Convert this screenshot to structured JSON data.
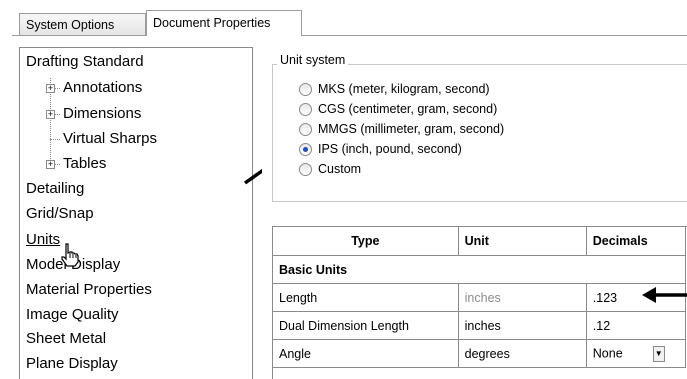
{
  "tabs": [
    {
      "label": "System Options",
      "active": false
    },
    {
      "label": "Document Properties",
      "active": true
    }
  ],
  "tree": {
    "items": [
      {
        "label": "Drafting Standard",
        "level": 0
      },
      {
        "label": "Annotations",
        "level": 1,
        "expandable": true
      },
      {
        "label": "Dimensions",
        "level": 1,
        "expandable": true
      },
      {
        "label": "Virtual Sharps",
        "level": 1,
        "expandable": false
      },
      {
        "label": "Tables",
        "level": 1,
        "expandable": true
      },
      {
        "label": "Detailing",
        "level": 0
      },
      {
        "label": "Grid/Snap",
        "level": 0
      },
      {
        "label": "Units",
        "level": 0,
        "selected": true
      },
      {
        "label": "Model Display",
        "level": 0
      },
      {
        "label": "Material Properties",
        "level": 0
      },
      {
        "label": "Image Quality",
        "level": 0
      },
      {
        "label": "Sheet Metal",
        "level": 0
      },
      {
        "label": "Plane Display",
        "level": 0
      }
    ]
  },
  "unit_system": {
    "title": "Unit system",
    "options": [
      {
        "label": "MKS  (meter, kilogram, second)",
        "checked": false
      },
      {
        "label": "CGS  (centimeter, gram, second)",
        "checked": false
      },
      {
        "label": "MMGS  (millimeter, gram, second)",
        "checked": false
      },
      {
        "label": "IPS  (inch, pound, second)",
        "checked": true
      },
      {
        "label": "Custom",
        "checked": false
      }
    ]
  },
  "units_table": {
    "headers": [
      "Type",
      "Unit",
      "Decimals"
    ],
    "section": "Basic Units",
    "rows": [
      {
        "type": "Length",
        "unit": "inches",
        "decimals": ".123",
        "unit_disabled": true
      },
      {
        "type": "Dual Dimension Length",
        "unit": "inches",
        "decimals": ".12",
        "unit_disabled": false
      },
      {
        "type": "Angle",
        "unit": "degrees",
        "decimals": "None",
        "unit_disabled": false
      }
    ]
  },
  "colors": {
    "accent_radio": "#1d4fb8",
    "border": "#8a8a8a",
    "disabled_text": "#8c8c8c"
  }
}
